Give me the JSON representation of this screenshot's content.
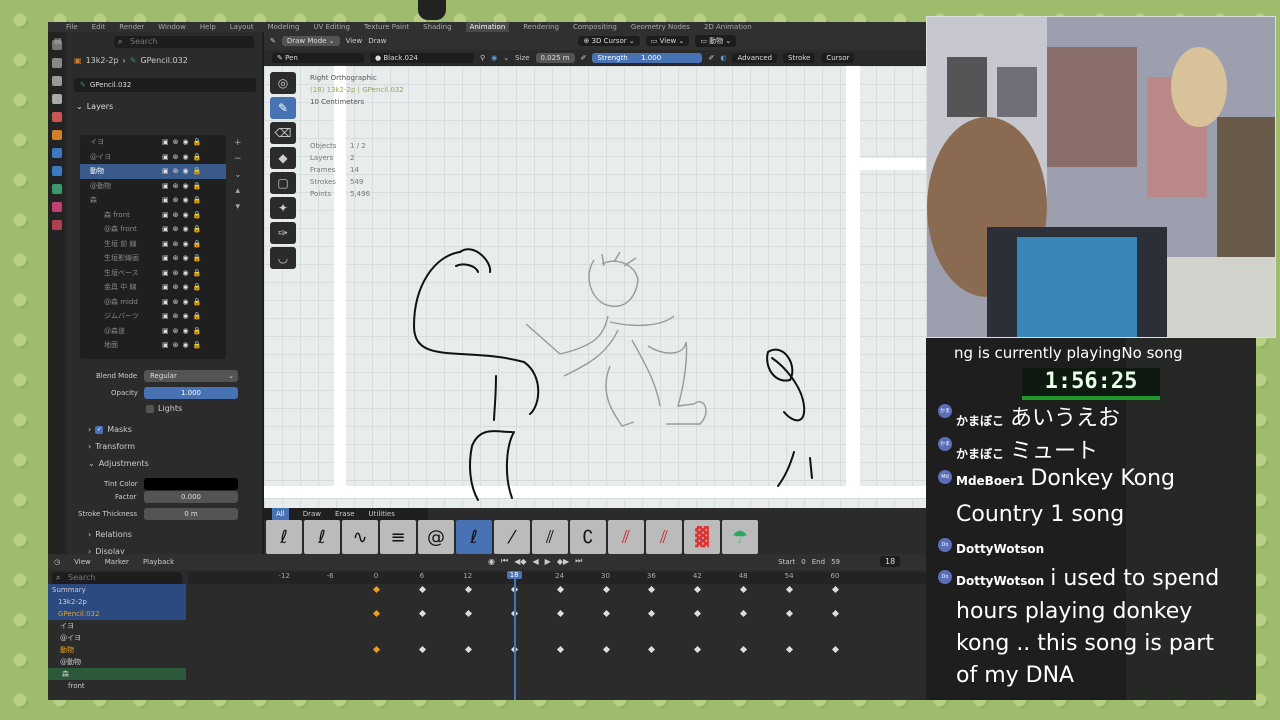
{
  "menubar": {
    "items": [
      "File",
      "Edit",
      "Render",
      "Window",
      "Help",
      "Layout",
      "Modeling",
      "UV Editing",
      "Texture Paint",
      "Shading",
      "Animation",
      "Rendering",
      "Compositing",
      "Geometry Nodes",
      "2D Animation"
    ],
    "active": "Animation"
  },
  "props": {
    "search_placeholder": "Search",
    "object_name": "13k2-2p",
    "data_name": "GPencil.032",
    "data_field": "GPencil.032",
    "layers_header": "Layers",
    "layers": [
      {
        "name": "イヨ",
        "indent": 0
      },
      {
        "name": "@イヨ",
        "indent": 0
      },
      {
        "name": "動物",
        "indent": 0,
        "selected": true
      },
      {
        "name": "@動物",
        "indent": 0
      },
      {
        "name": "森",
        "indent": 0,
        "group": true
      },
      {
        "name": "森 front",
        "indent": 1
      },
      {
        "name": "@森 front",
        "indent": 1
      },
      {
        "name": "生垣 前 線",
        "indent": 1
      },
      {
        "name": "生垣影線画",
        "indent": 1
      },
      {
        "name": "生垣ベース",
        "indent": 1
      },
      {
        "name": "金具 中 線",
        "indent": 1
      },
      {
        "name": "@森 midd",
        "indent": 1
      },
      {
        "name": "ジムバーツ",
        "indent": 1
      },
      {
        "name": "@森道",
        "indent": 1
      },
      {
        "name": "地面",
        "indent": 1
      }
    ],
    "blend_mode_label": "Blend Mode",
    "blend_mode": "Regular",
    "opacity_label": "Opacity",
    "opacity": "1.000",
    "lights_label": "Lights",
    "masks_label": "Masks",
    "transform_label": "Transform",
    "adjustments_label": "Adjustments",
    "tint_color_label": "Tint Color",
    "factor_label": "Factor",
    "factor": "0.000",
    "stroke_thickness_label": "Stroke Thickness",
    "stroke_thickness": "0 m",
    "relations_label": "Relations",
    "display_label": "Display"
  },
  "view_header": {
    "mode": "Draw Mode",
    "view": "View",
    "draw": "Draw",
    "cursor": "3D Cursor",
    "view2": "View",
    "collection": "動物"
  },
  "tool_header": {
    "brush": "Pen",
    "material": "Black.024",
    "size_label": "Size",
    "size": "0.025 m",
    "strength_label": "Strength",
    "strength": "1.000",
    "advanced": "Advanced",
    "stroke": "Stroke",
    "cursor": "Cursor"
  },
  "viewport": {
    "view_name": "Right Orthographic",
    "frame_info": "(18) 13k2-2p | GPencil.032",
    "scale": "10 Centimeters",
    "stats": [
      [
        "Objects",
        "1 / 2"
      ],
      [
        "Layers",
        "2"
      ],
      [
        "Frames",
        "14"
      ],
      [
        "Strokes",
        "549"
      ],
      [
        "Points",
        "5,496"
      ]
    ]
  },
  "brush_tabs": [
    "All",
    "Draw",
    "Erase",
    "Utilities"
  ],
  "timeline": {
    "menu": [
      "View",
      "Marker",
      "Playback"
    ],
    "current_frame": "18",
    "start_label": "Start",
    "start": "0",
    "end_label": "End",
    "end": "59",
    "search_placeholder": "Search",
    "ticks": [
      "-12",
      "-6",
      "0",
      "6",
      "12",
      "18",
      "24",
      "30",
      "36",
      "42",
      "48",
      "54",
      "60"
    ],
    "channels": [
      "Summary",
      "13k2-2p",
      "GPencil.032",
      "イヨ",
      "@イヨ",
      "動物",
      "@動物",
      "森",
      "front"
    ]
  },
  "chat": {
    "now_playing": "ng is currently playingNo song",
    "timer": "1:56:25",
    "messages": [
      {
        "user": "かまぼこ",
        "text": "あいうえお",
        "badge": "かま"
      },
      {
        "user": "かまぼこ",
        "text": "ミュート",
        "badge": "かま"
      },
      {
        "user": "MdeBoer1",
        "text": "Donkey Kong",
        "badge": "Md"
      },
      {
        "user": "",
        "text": "Country 1 song",
        "badge": ""
      },
      {
        "user": "DottyWotson",
        "text": "",
        "badge": "Do"
      },
      {
        "user": "DottyWotson",
        "text": "i used to spend",
        "badge": "Do"
      }
    ],
    "continuation": [
      "hours playing donkey",
      "kong .. this song is part",
      "of my DNA"
    ]
  }
}
